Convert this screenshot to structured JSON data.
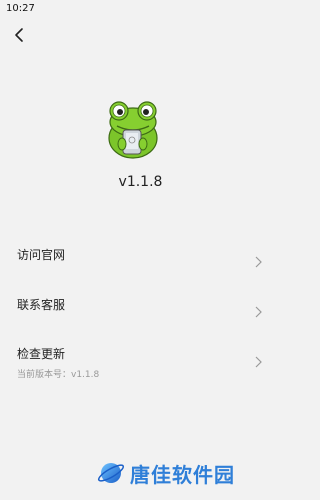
{
  "status_bar": {
    "time": "10:27"
  },
  "header": {
    "back_icon": "chevron-left-icon"
  },
  "app": {
    "logo_icon": "frog-logo-icon",
    "version": "v1.1.8"
  },
  "menu": [
    {
      "label": "访问官网",
      "sub": ""
    },
    {
      "label": "联系客服",
      "sub": ""
    },
    {
      "label": "检查更新",
      "sub": "当前版本号：v1.1.8"
    }
  ],
  "watermark": {
    "text": "唐佳软件园",
    "icon": "planet-icon"
  },
  "colors": {
    "background": "#f2f2f2",
    "watermark": "#2f7fd8",
    "frog": "#7cc52a"
  }
}
